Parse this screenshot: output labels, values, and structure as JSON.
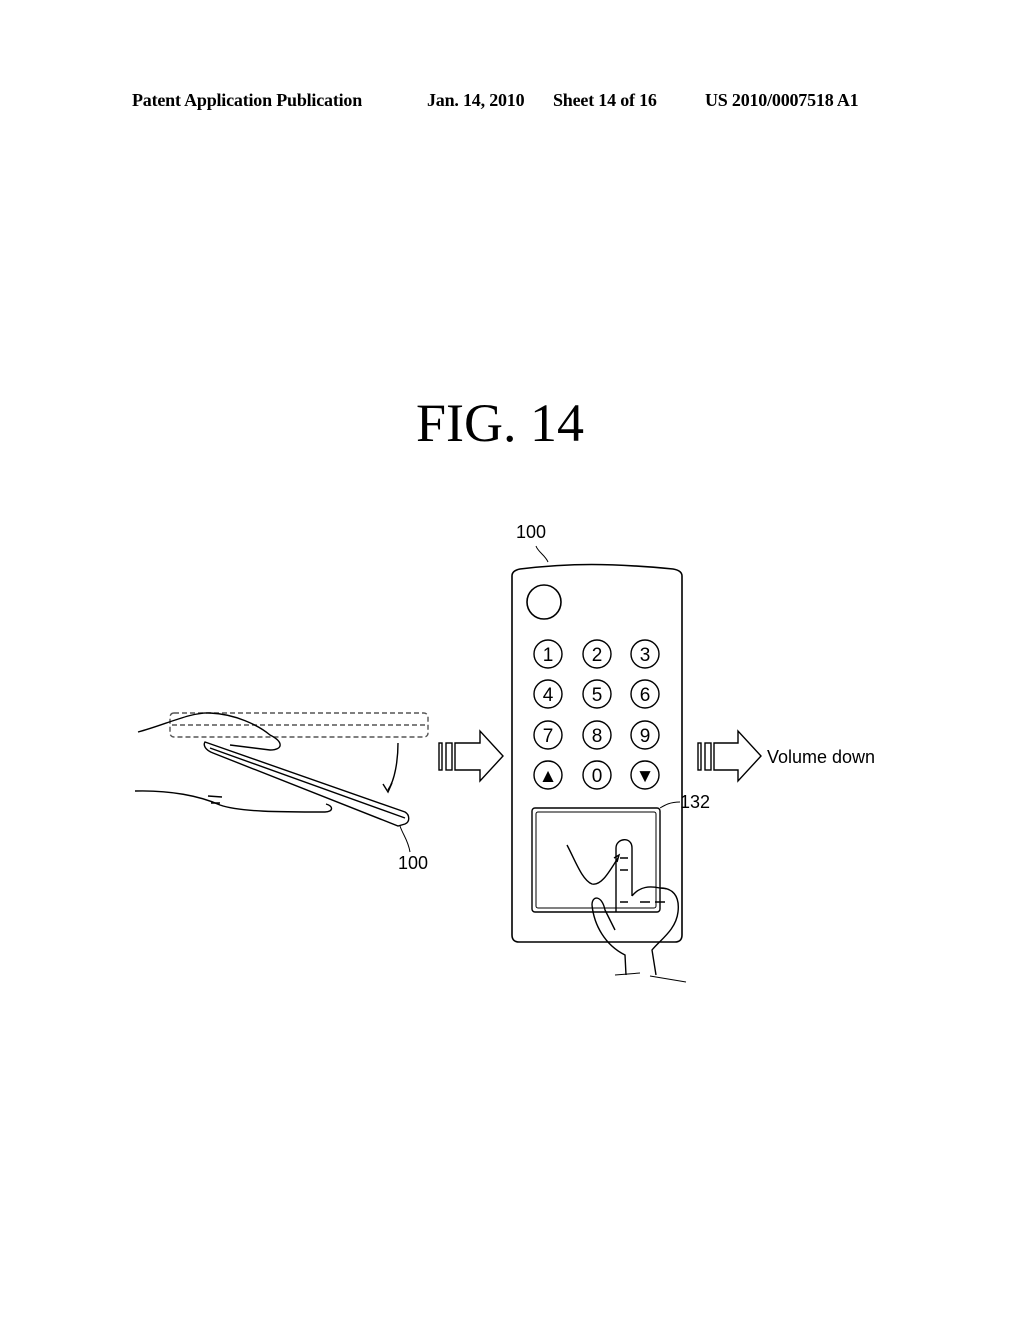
{
  "header": {
    "publication": "Patent Application Publication",
    "date": "Jan. 14, 2010",
    "sheet": "Sheet 14 of 16",
    "number": "US 2010/0007518 A1"
  },
  "figure": {
    "title": "FIG.  14",
    "labels": {
      "remote_top": "100",
      "remote_side": "100",
      "touchpad": "132",
      "result": "Volume down"
    },
    "keypad": [
      "1",
      "2",
      "3",
      "4",
      "5",
      "6",
      "7",
      "8",
      "9",
      "▲",
      "0",
      "▼"
    ],
    "icons": {
      "power_button": "circle",
      "gesture": "check-mark-gesture",
      "arrow1": "hollow-right-arrow",
      "arrow2": "hollow-right-arrow"
    }
  }
}
